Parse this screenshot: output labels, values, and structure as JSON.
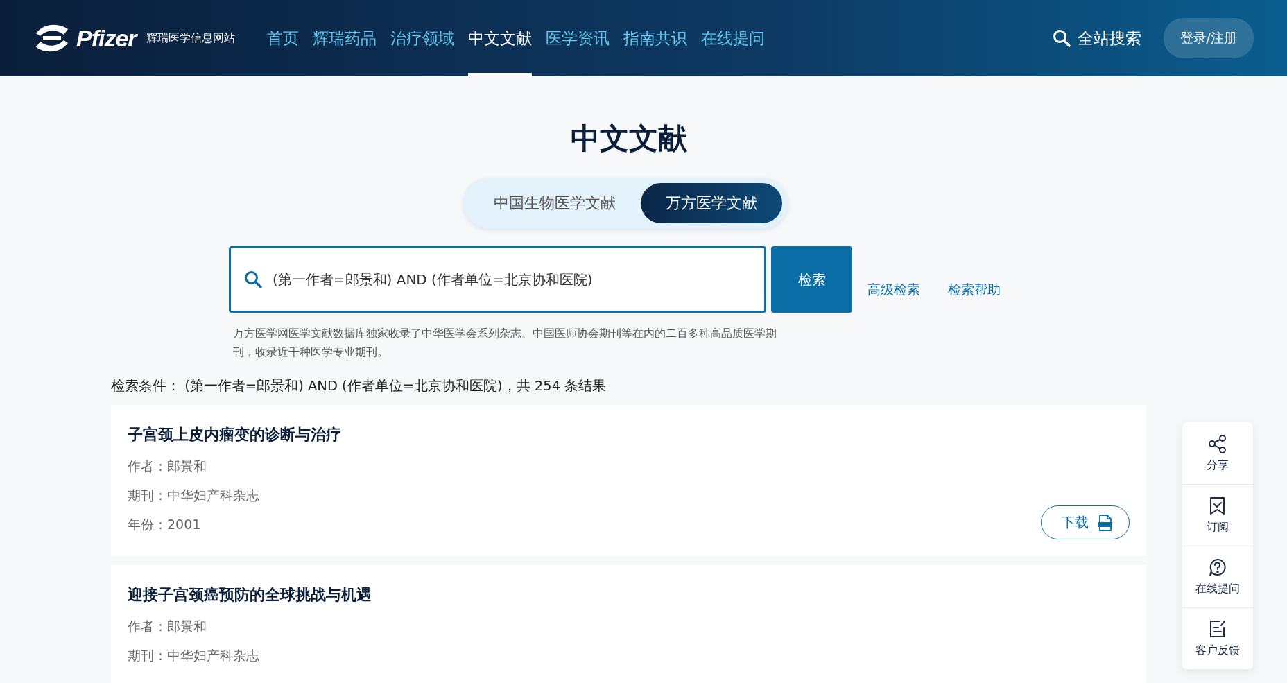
{
  "header": {
    "logo": "Pfizer",
    "site_name": "辉瑞医学信息网站",
    "nav": [
      {
        "label": "首页",
        "selected": false
      },
      {
        "label": "辉瑞药品",
        "selected": false
      },
      {
        "label": "治疗领域",
        "selected": false
      },
      {
        "label": "中文文献",
        "selected": true
      },
      {
        "label": "医学资讯",
        "selected": false
      },
      {
        "label": "指南共识",
        "selected": false
      },
      {
        "label": "在线提问",
        "selected": false
      }
    ],
    "search": "全站搜索",
    "login": "登录/注册"
  },
  "page_title": "中文文献",
  "source_tabs": [
    {
      "label": "中国生物医学文献",
      "selected": false
    },
    {
      "label": "万方医学文献",
      "selected": true
    }
  ],
  "search": {
    "value": "(第一作者=郎景和) AND (作者单位=北京协和医院)",
    "button": "检索",
    "links": [
      "高级检索",
      "检索帮助"
    ],
    "description": "万方医学网医学文献数据库独家收录了中华医学会系列杂志、中国医师协会期刊等在内的二百多种高品质医学期刊，收录近千种医学专业期刊。"
  },
  "summary": "检索条件： (第一作者=郎景和) AND (作者单位=北京协和医院)，共 254 条结果",
  "results": [
    {
      "title": "子宫颈上皮内瘤变的诊断与治疗",
      "fields": [
        "作者：郎景和",
        "期刊：中华妇产科杂志",
        "年份：2001"
      ],
      "download": "下载"
    },
    {
      "title": "迎接子宫颈癌预防的全球挑战与机遇",
      "fields": [
        "作者：郎景和",
        "期刊：中华妇产科杂志"
      ]
    }
  ],
  "side_tools": [
    {
      "kind": "share",
      "label": "分享"
    },
    {
      "kind": "subscribe",
      "label": "订阅"
    },
    {
      "kind": "question",
      "label": "在线提问"
    },
    {
      "kind": "feedback",
      "label": "客户反馈"
    }
  ]
}
